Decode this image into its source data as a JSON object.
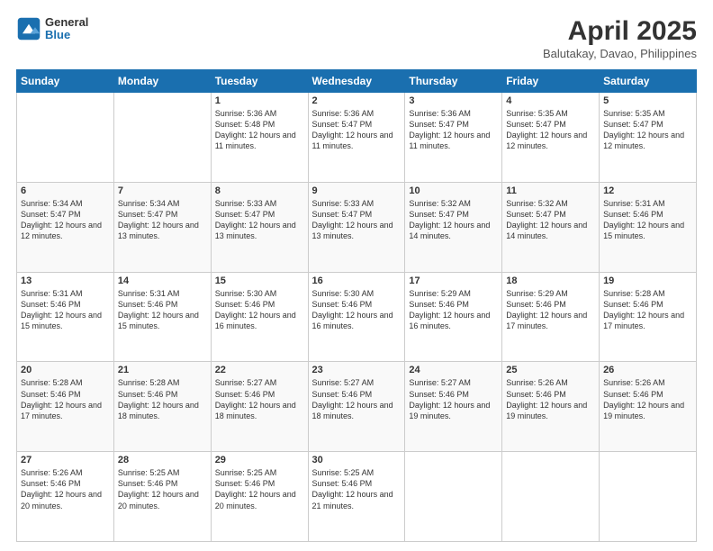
{
  "header": {
    "logo": {
      "general": "General",
      "blue": "Blue"
    },
    "title": "April 2025",
    "subtitle": "Balutakay, Davao, Philippines"
  },
  "days_of_week": [
    "Sunday",
    "Monday",
    "Tuesday",
    "Wednesday",
    "Thursday",
    "Friday",
    "Saturday"
  ],
  "weeks": [
    [
      {
        "day": "",
        "info": ""
      },
      {
        "day": "",
        "info": ""
      },
      {
        "day": "1",
        "info": "Sunrise: 5:36 AM\nSunset: 5:48 PM\nDaylight: 12 hours and 11 minutes."
      },
      {
        "day": "2",
        "info": "Sunrise: 5:36 AM\nSunset: 5:47 PM\nDaylight: 12 hours and 11 minutes."
      },
      {
        "day": "3",
        "info": "Sunrise: 5:36 AM\nSunset: 5:47 PM\nDaylight: 12 hours and 11 minutes."
      },
      {
        "day": "4",
        "info": "Sunrise: 5:35 AM\nSunset: 5:47 PM\nDaylight: 12 hours and 12 minutes."
      },
      {
        "day": "5",
        "info": "Sunrise: 5:35 AM\nSunset: 5:47 PM\nDaylight: 12 hours and 12 minutes."
      }
    ],
    [
      {
        "day": "6",
        "info": "Sunrise: 5:34 AM\nSunset: 5:47 PM\nDaylight: 12 hours and 12 minutes."
      },
      {
        "day": "7",
        "info": "Sunrise: 5:34 AM\nSunset: 5:47 PM\nDaylight: 12 hours and 13 minutes."
      },
      {
        "day": "8",
        "info": "Sunrise: 5:33 AM\nSunset: 5:47 PM\nDaylight: 12 hours and 13 minutes."
      },
      {
        "day": "9",
        "info": "Sunrise: 5:33 AM\nSunset: 5:47 PM\nDaylight: 12 hours and 13 minutes."
      },
      {
        "day": "10",
        "info": "Sunrise: 5:32 AM\nSunset: 5:47 PM\nDaylight: 12 hours and 14 minutes."
      },
      {
        "day": "11",
        "info": "Sunrise: 5:32 AM\nSunset: 5:47 PM\nDaylight: 12 hours and 14 minutes."
      },
      {
        "day": "12",
        "info": "Sunrise: 5:31 AM\nSunset: 5:46 PM\nDaylight: 12 hours and 15 minutes."
      }
    ],
    [
      {
        "day": "13",
        "info": "Sunrise: 5:31 AM\nSunset: 5:46 PM\nDaylight: 12 hours and 15 minutes."
      },
      {
        "day": "14",
        "info": "Sunrise: 5:31 AM\nSunset: 5:46 PM\nDaylight: 12 hours and 15 minutes."
      },
      {
        "day": "15",
        "info": "Sunrise: 5:30 AM\nSunset: 5:46 PM\nDaylight: 12 hours and 16 minutes."
      },
      {
        "day": "16",
        "info": "Sunrise: 5:30 AM\nSunset: 5:46 PM\nDaylight: 12 hours and 16 minutes."
      },
      {
        "day": "17",
        "info": "Sunrise: 5:29 AM\nSunset: 5:46 PM\nDaylight: 12 hours and 16 minutes."
      },
      {
        "day": "18",
        "info": "Sunrise: 5:29 AM\nSunset: 5:46 PM\nDaylight: 12 hours and 17 minutes."
      },
      {
        "day": "19",
        "info": "Sunrise: 5:28 AM\nSunset: 5:46 PM\nDaylight: 12 hours and 17 minutes."
      }
    ],
    [
      {
        "day": "20",
        "info": "Sunrise: 5:28 AM\nSunset: 5:46 PM\nDaylight: 12 hours and 17 minutes."
      },
      {
        "day": "21",
        "info": "Sunrise: 5:28 AM\nSunset: 5:46 PM\nDaylight: 12 hours and 18 minutes."
      },
      {
        "day": "22",
        "info": "Sunrise: 5:27 AM\nSunset: 5:46 PM\nDaylight: 12 hours and 18 minutes."
      },
      {
        "day": "23",
        "info": "Sunrise: 5:27 AM\nSunset: 5:46 PM\nDaylight: 12 hours and 18 minutes."
      },
      {
        "day": "24",
        "info": "Sunrise: 5:27 AM\nSunset: 5:46 PM\nDaylight: 12 hours and 19 minutes."
      },
      {
        "day": "25",
        "info": "Sunrise: 5:26 AM\nSunset: 5:46 PM\nDaylight: 12 hours and 19 minutes."
      },
      {
        "day": "26",
        "info": "Sunrise: 5:26 AM\nSunset: 5:46 PM\nDaylight: 12 hours and 19 minutes."
      }
    ],
    [
      {
        "day": "27",
        "info": "Sunrise: 5:26 AM\nSunset: 5:46 PM\nDaylight: 12 hours and 20 minutes."
      },
      {
        "day": "28",
        "info": "Sunrise: 5:25 AM\nSunset: 5:46 PM\nDaylight: 12 hours and 20 minutes."
      },
      {
        "day": "29",
        "info": "Sunrise: 5:25 AM\nSunset: 5:46 PM\nDaylight: 12 hours and 20 minutes."
      },
      {
        "day": "30",
        "info": "Sunrise: 5:25 AM\nSunset: 5:46 PM\nDaylight: 12 hours and 21 minutes."
      },
      {
        "day": "",
        "info": ""
      },
      {
        "day": "",
        "info": ""
      },
      {
        "day": "",
        "info": ""
      }
    ]
  ]
}
